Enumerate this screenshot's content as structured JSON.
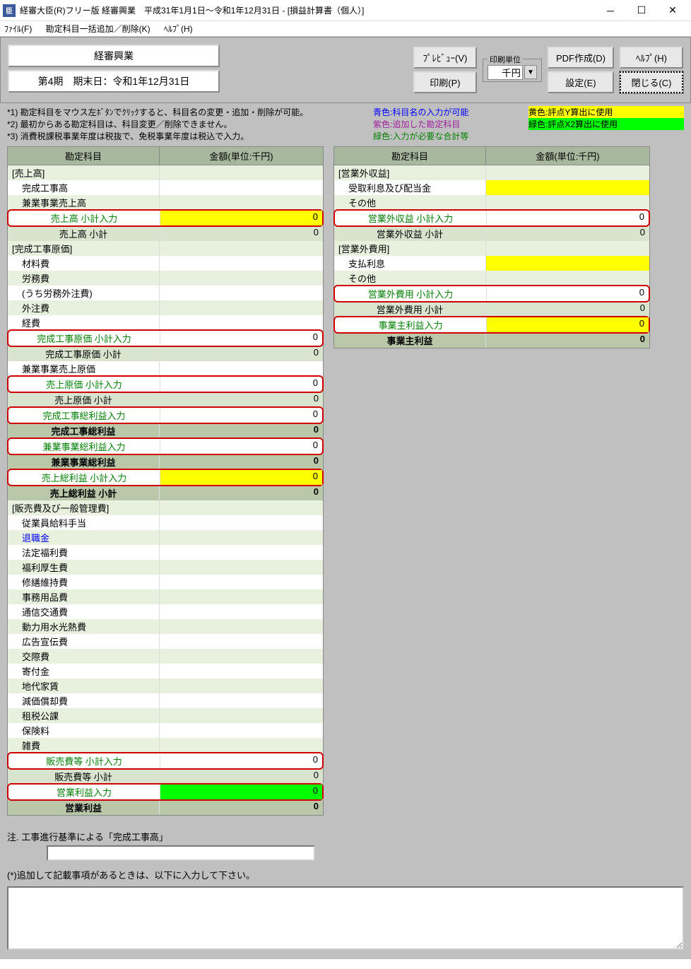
{
  "window": {
    "title": "経審大臣(R)フリー版  経審興業　平成31年1月1日～令和1年12月31日 - [損益計算書（個人）]",
    "icon": "臣"
  },
  "menu": {
    "file": "ﾌｧｲﾙ(F)",
    "bulk": "勘定科目一括追加／削除(K)",
    "help": "ﾍﾙﾌﾟ(H)"
  },
  "info": {
    "company": "経審興業",
    "period": "第4期　期末日：令和1年12月31日"
  },
  "toolbar": {
    "preview": "ﾌﾟﾚﾋﾞｭｰ(V)",
    "print": "印刷(P)",
    "unit_label": "印刷単位",
    "unit_value": "千円",
    "pdf": "PDF作成(D)",
    "settings": "設定(E)",
    "help": "ﾍﾙﾌﾟ(H)",
    "close": "閉じる(C)"
  },
  "notes": {
    "n1": "*1) 勘定科目をマウス左ﾎﾞﾀﾝでｸﾘｯｸすると、科目名の変更・追加・削除が可能。",
    "n2": "*2) 最初からある勘定科目は、科目変更／削除できません。",
    "n3": "*3) 消費税課税事業年度は税抜で、免税事業年度は税込で入力。",
    "blue": "青色:科目名の入力が可能",
    "purple": "紫色:追加した勘定科目",
    "green": "緑色:入力が必要な合計等",
    "yellow": "黄色:評点Y算出に使用",
    "lime": "緑色:評点X2算出に使用"
  },
  "headers": {
    "name": "勘定科目",
    "amount": "金額(単位:千円)"
  },
  "left": [
    {
      "t": "header",
      "n": "[売上高]"
    },
    {
      "t": "item",
      "n": "完成工事高"
    },
    {
      "t": "item",
      "n": "兼業事業売上高",
      "alt": true
    },
    {
      "t": "green",
      "n": "売上高  小計入力",
      "a": "0",
      "y": true
    },
    {
      "t": "sub",
      "n": "売上高  小計",
      "a": "0"
    },
    {
      "t": "header",
      "n": "[完成工事原価]"
    },
    {
      "t": "item",
      "n": "材料費"
    },
    {
      "t": "item",
      "n": "労務費",
      "alt": true
    },
    {
      "t": "item",
      "n": "(うち労務外注費)"
    },
    {
      "t": "item",
      "n": "外注費",
      "alt": true
    },
    {
      "t": "item",
      "n": "経費"
    },
    {
      "t": "green",
      "n": "完成工事原価  小計入力",
      "a": "0"
    },
    {
      "t": "sub",
      "n": "完成工事原価  小計",
      "a": "0"
    },
    {
      "t": "item",
      "n": "兼業事業売上原価"
    },
    {
      "t": "green",
      "n": "売上原価  小計入力",
      "a": "0"
    },
    {
      "t": "sub",
      "n": "売上原価  小計",
      "a": "0"
    },
    {
      "t": "green",
      "n": "完成工事総利益入力",
      "a": "0"
    },
    {
      "t": "bold",
      "n": "完成工事総利益",
      "a": "0"
    },
    {
      "t": "green",
      "n": "兼業事業総利益入力",
      "a": "0"
    },
    {
      "t": "bold",
      "n": "兼業事業総利益",
      "a": "0"
    },
    {
      "t": "green",
      "n": "売上総利益  小計入力",
      "a": "0",
      "y": true
    },
    {
      "t": "bold",
      "n": "売上総利益  小計",
      "a": "0"
    },
    {
      "t": "header",
      "n": "[販売費及び一般管理費]"
    },
    {
      "t": "item",
      "n": "従業員給料手当"
    },
    {
      "t": "item",
      "n": "退職金",
      "alt": true,
      "blue": true
    },
    {
      "t": "item",
      "n": "法定福利費"
    },
    {
      "t": "item",
      "n": "福利厚生費",
      "alt": true
    },
    {
      "t": "item",
      "n": "修繕維持費"
    },
    {
      "t": "item",
      "n": "事務用品費",
      "alt": true
    },
    {
      "t": "item",
      "n": "通信交通費"
    },
    {
      "t": "item",
      "n": "動力用水光熱費",
      "alt": true
    },
    {
      "t": "item",
      "n": "広告宣伝費"
    },
    {
      "t": "item",
      "n": "交際費",
      "alt": true
    },
    {
      "t": "item",
      "n": "寄付金"
    },
    {
      "t": "item",
      "n": "地代家賃",
      "alt": true
    },
    {
      "t": "item",
      "n": "減価償却費"
    },
    {
      "t": "item",
      "n": "租税公課",
      "alt": true
    },
    {
      "t": "item",
      "n": "保険料"
    },
    {
      "t": "item",
      "n": "雑費",
      "alt": true
    },
    {
      "t": "green",
      "n": "販売費等  小計入力",
      "a": "0"
    },
    {
      "t": "sub",
      "n": "販売費等  小計",
      "a": "0"
    },
    {
      "t": "green",
      "n": "営業利益入力",
      "a": "0",
      "g": true
    },
    {
      "t": "bold",
      "n": "営業利益",
      "a": "0"
    }
  ],
  "right": [
    {
      "t": "header",
      "n": "[営業外収益]"
    },
    {
      "t": "item",
      "n": "受取利息及び配当金",
      "y": true
    },
    {
      "t": "item",
      "n": "その他",
      "alt": true
    },
    {
      "t": "green",
      "n": "営業外収益  小計入力",
      "a": "0"
    },
    {
      "t": "sub",
      "n": "営業外収益  小計",
      "a": "0"
    },
    {
      "t": "header",
      "n": "[営業外費用]"
    },
    {
      "t": "item",
      "n": "支払利息",
      "y": true
    },
    {
      "t": "item",
      "n": "その他",
      "alt": true
    },
    {
      "t": "green",
      "n": "営業外費用  小計入力",
      "a": "0"
    },
    {
      "t": "sub",
      "n": "営業外費用  小計",
      "a": "0"
    },
    {
      "t": "green",
      "n": "事業主利益入力",
      "a": "0",
      "y": true
    },
    {
      "t": "bold",
      "n": "事業主利益",
      "a": "0"
    }
  ],
  "footer": {
    "note_label": "注.  工事進行基準による「完成工事高」",
    "extra_label": "(*)追加して記載事項があるときは、以下に入力して下さい。"
  }
}
